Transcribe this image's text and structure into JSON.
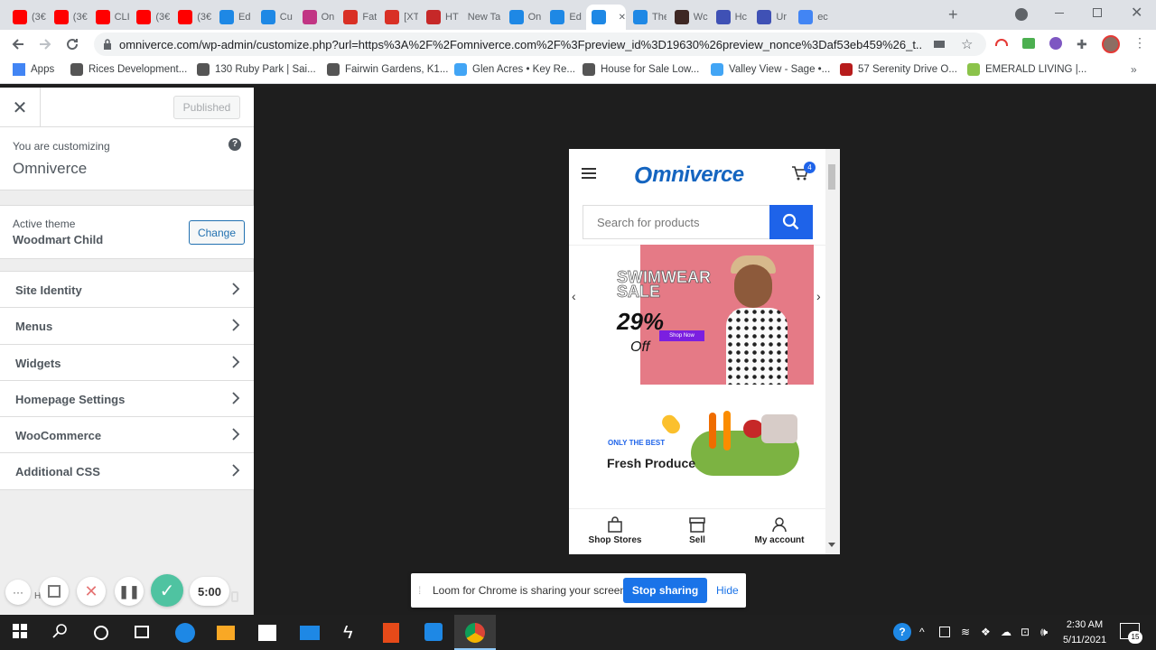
{
  "browser": {
    "tabs": [
      {
        "title": "(3€",
        "icon": "youtube-icon",
        "color": "#ff0000"
      },
      {
        "title": "(3€",
        "icon": "youtube-icon",
        "color": "#ff0000"
      },
      {
        "title": "CLI",
        "icon": "youtube-icon",
        "color": "#ff0000"
      },
      {
        "title": "(3€",
        "icon": "youtube-icon",
        "color": "#ff0000"
      },
      {
        "title": "(3€",
        "icon": "youtube-icon",
        "color": "#ff0000"
      },
      {
        "title": "Ed",
        "icon": "omniverce-icon",
        "color": "#1e88e5"
      },
      {
        "title": "Cu",
        "icon": "omniverce-icon",
        "color": "#1e88e5"
      },
      {
        "title": "On",
        "icon": "instagram-icon",
        "color": "#c13584"
      },
      {
        "title": "Fat",
        "icon": "gmail-icon",
        "color": "#d93025"
      },
      {
        "title": "[XT",
        "icon": "gmail-icon",
        "color": "#d93025"
      },
      {
        "title": "HT",
        "icon": "x-icon",
        "color": "#c62828"
      },
      {
        "title": "New Ta",
        "icon": "",
        "color": "#dee1e6"
      },
      {
        "title": "On",
        "icon": "omniverce-icon",
        "color": "#1e88e5"
      },
      {
        "title": "Ed",
        "icon": "omniverce-icon",
        "color": "#1e88e5"
      },
      {
        "title": "",
        "icon": "omniverce-icon",
        "color": "#1e88e5"
      },
      {
        "title": "The",
        "icon": "omniverce-icon",
        "color": "#1e88e5"
      },
      {
        "title": "Wc",
        "icon": "book-icon",
        "color": "#3e2723"
      },
      {
        "title": "Hc",
        "icon": "c-icon",
        "color": "#3f51b5"
      },
      {
        "title": "Ur",
        "icon": "c-icon",
        "color": "#3f51b5"
      },
      {
        "title": "ec",
        "icon": "google-icon",
        "color": "#4285f4"
      }
    ],
    "url": "omniverce.com/wp-admin/customize.php?url=https%3A%2F%2Fomniverce.com%2F%3Fpreview_id%3D19630%26preview_nonce%3Daf53eb459%26_t...",
    "bookmarks": [
      {
        "label": "Apps"
      },
      {
        "label": "Rices Development..."
      },
      {
        "label": "130 Ruby Park | Sai..."
      },
      {
        "label": "Fairwin Gardens, K1..."
      },
      {
        "label": "Glen Acres • Key Re..."
      },
      {
        "label": "House for Sale Low..."
      },
      {
        "label": "Valley View - Sage •..."
      },
      {
        "label": "57 Serenity Drive O..."
      },
      {
        "label": "EMERALD LIVING |..."
      }
    ]
  },
  "customizer": {
    "published_label": "Published",
    "customizing_label": "You are customizing",
    "site_name": "Omniverce",
    "active_theme_label": "Active theme",
    "theme_name": "Woodmart Child",
    "change_label": "Change",
    "menu": [
      "Site Identity",
      "Menus",
      "Widgets",
      "Homepage Settings",
      "WooCommerce",
      "Additional CSS"
    ],
    "hidden_label": "H... or"
  },
  "loom": {
    "timer": "5:00",
    "share_text": "Loom for Chrome is sharing your screen.",
    "stop_label": "Stop sharing",
    "hide_label": "Hide"
  },
  "preview": {
    "logo_text": "mniverce",
    "logo_initial": "O",
    "cart_count": "4",
    "search_placeholder": "Search for products",
    "banner": {
      "line1": "SWIMWEAR",
      "line2": "SALE",
      "percent": "29%",
      "off": "Off",
      "button": "Shop Now"
    },
    "promo": {
      "kicker": "ONLY THE BEST",
      "title": "Fresh Produce"
    },
    "bottom_nav": [
      "Shop Stores",
      "Sell",
      "My account"
    ]
  },
  "taskbar": {
    "time": "2:30 AM",
    "date": "5/11/2021",
    "notif_count": "15"
  }
}
